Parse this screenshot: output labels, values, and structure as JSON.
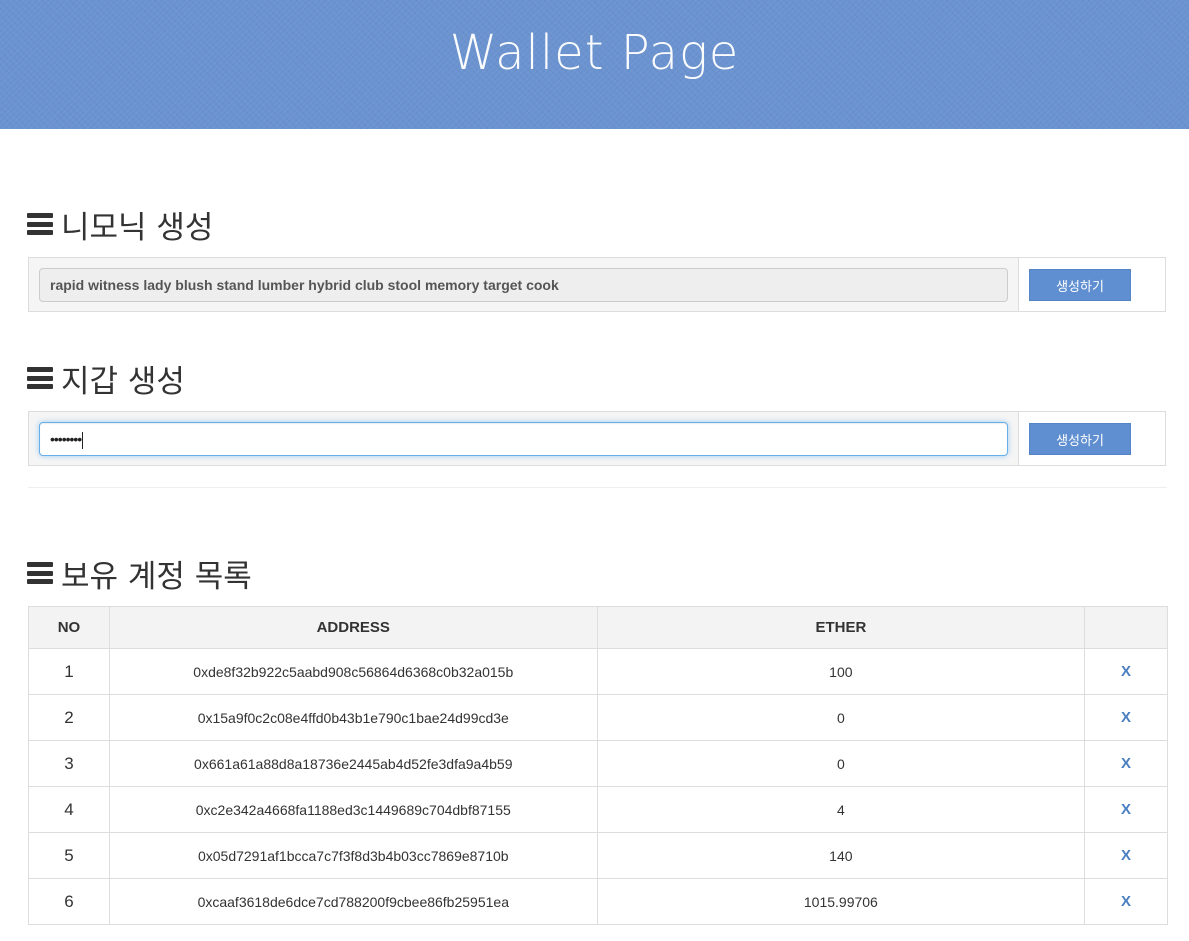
{
  "header": {
    "title": "Wallet Page"
  },
  "mnemonic_section": {
    "title": "니모닉 생성",
    "value": "rapid witness lady blush stand lumber hybrid club stool memory target cook",
    "button_label": "생성하기"
  },
  "wallet_section": {
    "title": "지갑 생성",
    "password_mask": "••••••••",
    "button_label": "생성하기"
  },
  "accounts_section": {
    "title": "보유 계정 목록",
    "columns": [
      "NO",
      "ADDRESS",
      "ETHER",
      ""
    ],
    "rows": [
      {
        "no": "1",
        "address": "0xde8f32b922c5aabd908c56864d6368c0b32a015b",
        "ether": "100",
        "action": "X"
      },
      {
        "no": "2",
        "address": "0x15a9f0c2c08e4ffd0b43b1e790c1bae24d99cd3e",
        "ether": "0",
        "action": "X"
      },
      {
        "no": "3",
        "address": "0x661a61a88d8a18736e2445ab4d52fe3dfa9a4b59",
        "ether": "0",
        "action": "X"
      },
      {
        "no": "4",
        "address": "0xc2e342a4668fa1188ed3c1449689c704dbf87155",
        "ether": "4",
        "action": "X"
      },
      {
        "no": "5",
        "address": "0x05d7291af1bcca7c7f3f8d3b4b03cc7869e8710b",
        "ether": "140",
        "action": "X"
      },
      {
        "no": "6",
        "address": "0xcaaf3618de6dce7cd788200f9cbee86fb25951ea",
        "ether": "1015.99706",
        "action": "X"
      }
    ]
  },
  "colors": {
    "header_bg": "#6b93d0",
    "button_bg": "#5f8fd1",
    "link": "#4a7fc2"
  }
}
